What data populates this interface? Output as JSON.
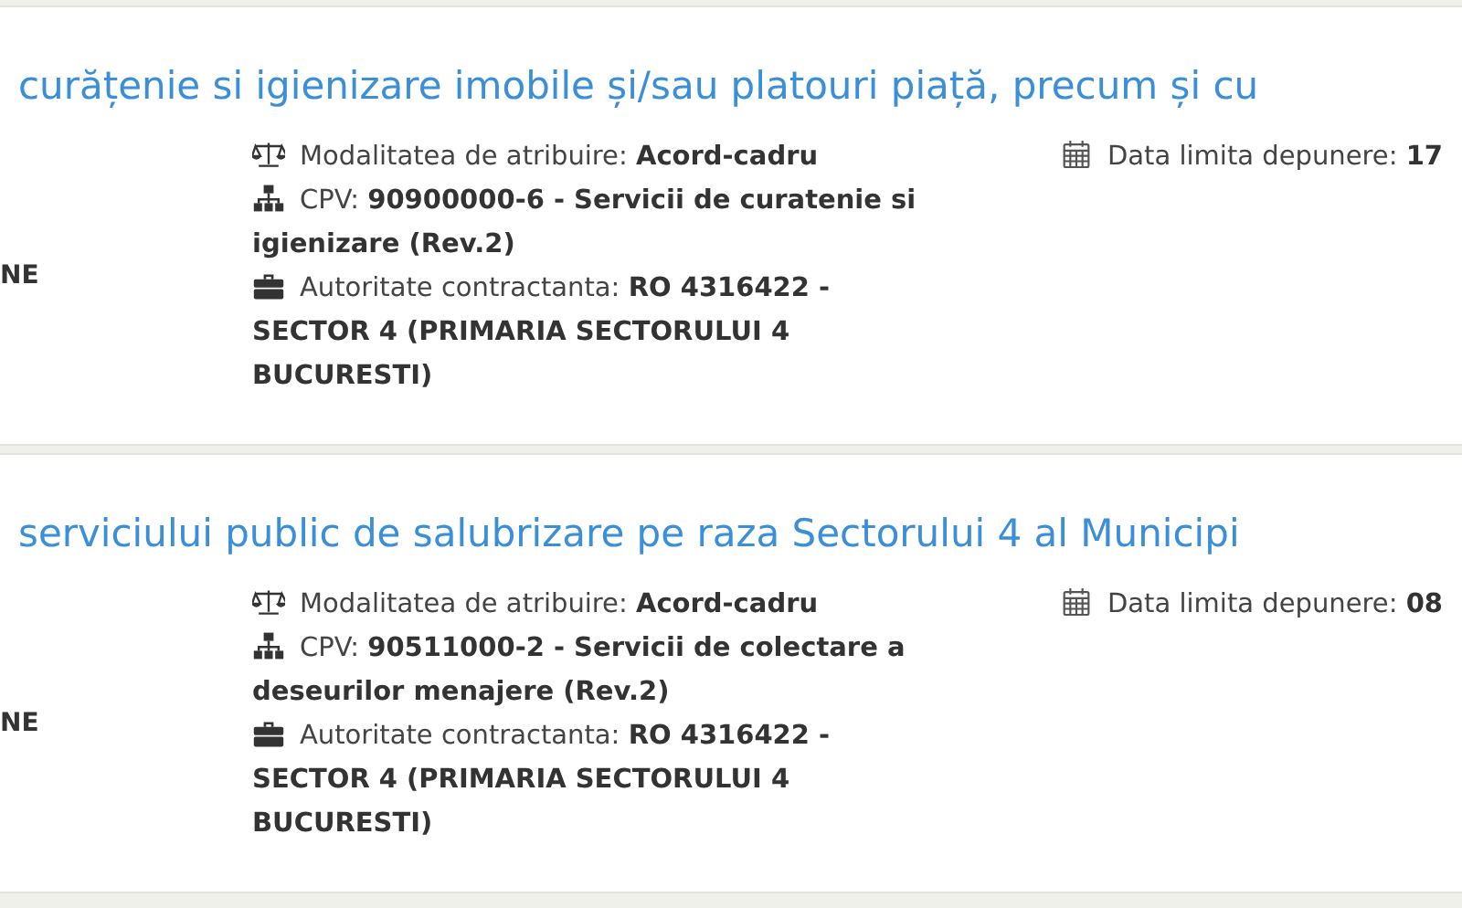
{
  "listings": [
    {
      "title": "curățenie si igienizare imobile și/sau platouri piață, precum și cu",
      "left_text": "NE",
      "details": [
        {
          "kind": "award",
          "text": "Modalitatea de atribuire: **Acord-cadru**"
        },
        {
          "kind": "cpv",
          "text": "CPV: **90900000-6 - Servicii de curatenie si igienizare (Rev.2)**"
        },
        {
          "kind": "authority",
          "text": "Autoritate contractanta: **RO 4316422 - SECTOR 4 (PRIMARIA SECTORULUI 4 BUCURESTI)**"
        }
      ],
      "deadline": "Data limita depunere: **17**"
    },
    {
      "title": "serviciului public de salubrizare pe raza Sectorului 4 al Municipi",
      "left_text": "NE",
      "details": [
        {
          "kind": "award",
          "text": "Modalitatea de atribuire: **Acord-cadru**"
        },
        {
          "kind": "cpv",
          "text": "CPV: **90511000-2 - Servicii de colectare a deseurilor menajere (Rev.2)**"
        },
        {
          "kind": "authority",
          "text": "Autoritate contractanta: **RO 4316422 - SECTOR 4 (PRIMARIA SECTORULUI 4 BUCURESTI)**"
        }
      ],
      "deadline": "Data limita depunere: **08**"
    }
  ]
}
